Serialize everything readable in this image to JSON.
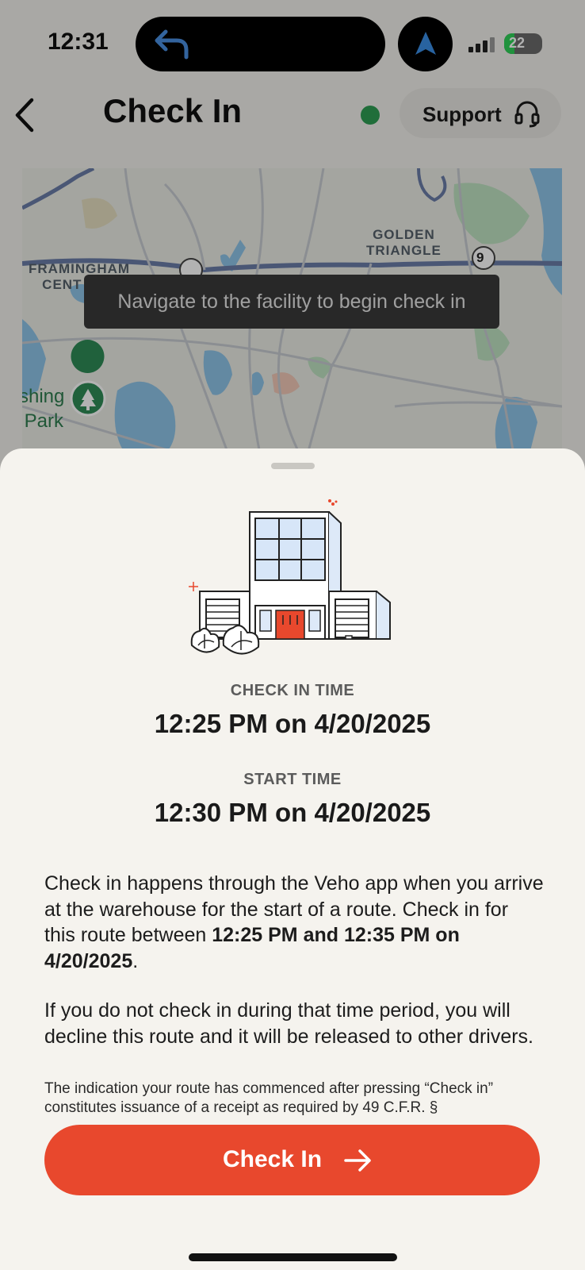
{
  "status_bar": {
    "time": "12:31",
    "battery": "22"
  },
  "header": {
    "title": "Check In",
    "support_label": "Support",
    "status_color": "#2e9e54"
  },
  "map": {
    "labels": {
      "golden_triangle": "GOLDEN\nTRIANGLE",
      "framingham": "FRAMINGHAM\nCENT",
      "park": "shing\nPark",
      "route_9": "9"
    },
    "toast": "Navigate to the facility to begin check in"
  },
  "sheet": {
    "check_in_time_label": "CHECK IN TIME",
    "check_in_time_value": "12:25 PM on 4/20/2025",
    "start_time_label": "START TIME",
    "start_time_value": "12:30 PM on 4/20/2025",
    "para1_text": "Check in happens through the Veho app when you arrive at the warehouse for the start of a route. Check in for this route between ",
    "para1_bold": "12:25 PM and 12:35 PM on 4/20/2025",
    "para1_end": ".",
    "para2": "If you do not check in during that time period, you will decline this route and it will be released to other drivers.",
    "fine_print": "The indication your route has commenced after pressing “Check in” constitutes issuance of a receipt as required by 49 C.F.R. §",
    "cta_label": "Check In"
  },
  "colors": {
    "accent": "#e8482d",
    "background": "#f5f3ee"
  },
  "icons": {
    "back": "chevron-left-icon",
    "support": "headset-icon",
    "cta": "arrow-right-icon",
    "island": "turn-left-arrow-icon",
    "nav": "navigation-arrow-icon"
  }
}
